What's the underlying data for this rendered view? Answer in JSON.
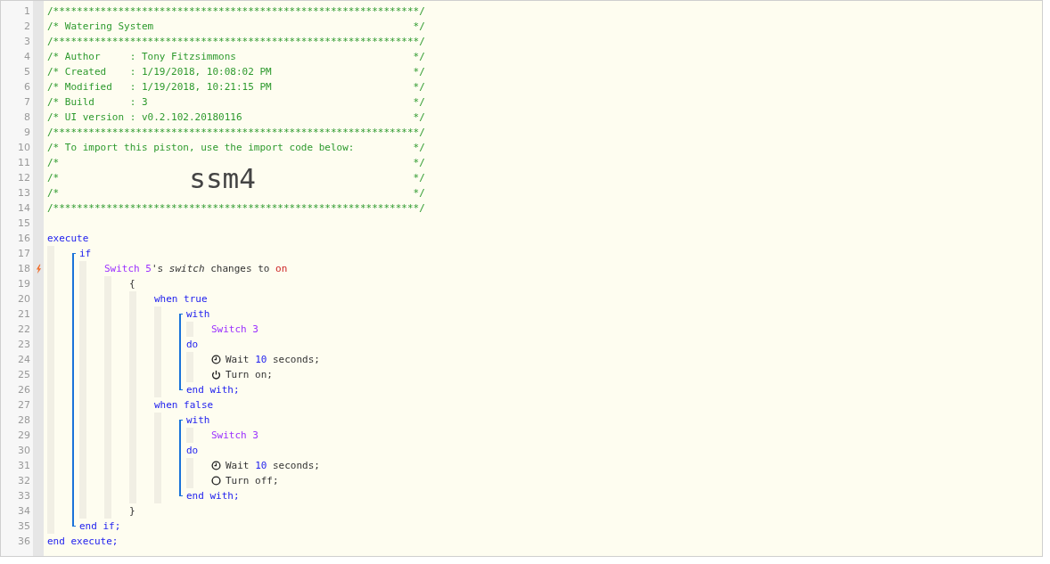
{
  "lines": [
    {
      "n": "1",
      "trigger": false,
      "tokens": [
        {
          "kind": "comment",
          "text": "/**************************************************************/"
        }
      ]
    },
    {
      "n": "2",
      "trigger": false,
      "tokens": [
        {
          "kind": "comment",
          "text": "/* Watering System"
        },
        {
          "kind": "comment-end",
          "text": "*/"
        }
      ]
    },
    {
      "n": "3",
      "trigger": false,
      "tokens": [
        {
          "kind": "comment",
          "text": "/**************************************************************/"
        }
      ]
    },
    {
      "n": "4",
      "trigger": false,
      "tokens": [
        {
          "kind": "comment",
          "text": "/* Author     : Tony Fitzsimmons"
        },
        {
          "kind": "comment-end",
          "text": "*/"
        }
      ]
    },
    {
      "n": "5",
      "trigger": false,
      "tokens": [
        {
          "kind": "comment",
          "text": "/* Created    : 1/19/2018, 10:08:02 PM"
        },
        {
          "kind": "comment-end",
          "text": "*/"
        }
      ]
    },
    {
      "n": "6",
      "trigger": false,
      "tokens": [
        {
          "kind": "comment",
          "text": "/* Modified   : 1/19/2018, 10:21:15 PM"
        },
        {
          "kind": "comment-end",
          "text": "*/"
        }
      ]
    },
    {
      "n": "7",
      "trigger": false,
      "tokens": [
        {
          "kind": "comment",
          "text": "/* Build      : 3"
        },
        {
          "kind": "comment-end",
          "text": "*/"
        }
      ]
    },
    {
      "n": "8",
      "trigger": false,
      "tokens": [
        {
          "kind": "comment",
          "text": "/* UI version : v0.2.102.20180116"
        },
        {
          "kind": "comment-end",
          "text": "*/"
        }
      ]
    },
    {
      "n": "9",
      "trigger": false,
      "tokens": [
        {
          "kind": "comment",
          "text": "/**************************************************************/"
        }
      ]
    },
    {
      "n": "10",
      "trigger": false,
      "tokens": [
        {
          "kind": "comment",
          "text": "/* To import this piston, use the import code below:"
        },
        {
          "kind": "comment-end",
          "text": "*/"
        }
      ]
    },
    {
      "n": "11",
      "trigger": false,
      "tokens": [
        {
          "kind": "comment",
          "text": "/*"
        },
        {
          "kind": "comment-end",
          "text": "*/"
        }
      ]
    },
    {
      "n": "12",
      "trigger": false,
      "tokens": [
        {
          "kind": "comment",
          "text": "/*"
        },
        {
          "kind": "import-code",
          "text": "ssm4"
        },
        {
          "kind": "comment-end",
          "text": "*/"
        }
      ]
    },
    {
      "n": "13",
      "trigger": false,
      "tokens": [
        {
          "kind": "comment",
          "text": "/*"
        },
        {
          "kind": "comment-end",
          "text": "*/"
        }
      ]
    },
    {
      "n": "14",
      "trigger": false,
      "tokens": [
        {
          "kind": "comment",
          "text": "/**************************************************************/"
        }
      ]
    },
    {
      "n": "15",
      "trigger": false
    },
    {
      "n": "16",
      "trigger": false,
      "tokens": [
        {
          "kind": "keyword",
          "text": "execute"
        }
      ],
      "children": [
        {
          "block": [
            {
              "n": "17",
              "trigger": false,
              "tokens": [
                {
                  "kind": "keyword",
                  "text": "if"
                }
              ],
              "children": [
                {
                  "n": "18",
                  "trigger": true,
                  "tokens": [
                    {
                      "kind": "device",
                      "text": "Switch 5"
                    },
                    {
                      "kind": "plain",
                      "text": "'s "
                    },
                    {
                      "kind": "attribute",
                      "text": "switch"
                    },
                    {
                      "kind": "plain",
                      "text": " changes to "
                    },
                    {
                      "kind": "value",
                      "text": "on"
                    }
                  ],
                  "children": [
                    {
                      "n": "19",
                      "trigger": false,
                      "tokens": [
                        {
                          "kind": "plain",
                          "text": "{"
                        }
                      ],
                      "children": [
                        {
                          "n": "20",
                          "trigger": false,
                          "tokens": [
                            {
                              "kind": "keyword",
                              "text": "when true"
                            }
                          ],
                          "children": [
                            {
                              "block": [
                                {
                                  "n": "21",
                                  "trigger": false,
                                  "tokens": [
                                    {
                                      "kind": "keyword",
                                      "text": "with"
                                    }
                                  ],
                                  "children": [
                                    {
                                      "n": "22",
                                      "trigger": false,
                                      "tokens": [
                                        {
                                          "kind": "device",
                                          "text": "Switch 3"
                                        }
                                      ]
                                    }
                                  ]
                                },
                                {
                                  "n": "23",
                                  "trigger": false,
                                  "tokens": [
                                    {
                                      "kind": "keyword",
                                      "text": "do"
                                    }
                                  ],
                                  "children": [
                                    {
                                      "n": "24",
                                      "trigger": false,
                                      "tokens": [
                                        {
                                          "kind": "clock-icon"
                                        },
                                        {
                                          "kind": "plain",
                                          "text": "Wait "
                                        },
                                        {
                                          "kind": "number",
                                          "text": "10"
                                        },
                                        {
                                          "kind": "plain",
                                          "text": " seconds;"
                                        }
                                      ]
                                    },
                                    {
                                      "n": "25",
                                      "trigger": false,
                                      "tokens": [
                                        {
                                          "kind": "power-icon"
                                        },
                                        {
                                          "kind": "plain",
                                          "text": "Turn on;"
                                        }
                                      ]
                                    }
                                  ]
                                }
                              ],
                              "end": {
                                "n": "26",
                                "trigger": false,
                                "tokens": [
                                  {
                                    "kind": "keyword",
                                    "text": "end with;"
                                  }
                                ]
                              }
                            }
                          ]
                        },
                        {
                          "n": "27",
                          "trigger": false,
                          "tokens": [
                            {
                              "kind": "keyword",
                              "text": "when false"
                            }
                          ],
                          "children": [
                            {
                              "block": [
                                {
                                  "n": "28",
                                  "trigger": false,
                                  "tokens": [
                                    {
                                      "kind": "keyword",
                                      "text": "with"
                                    }
                                  ],
                                  "children": [
                                    {
                                      "n": "29",
                                      "trigger": false,
                                      "tokens": [
                                        {
                                          "kind": "device",
                                          "text": "Switch 3"
                                        }
                                      ]
                                    }
                                  ]
                                },
                                {
                                  "n": "30",
                                  "trigger": false,
                                  "tokens": [
                                    {
                                      "kind": "keyword",
                                      "text": "do"
                                    }
                                  ],
                                  "children": [
                                    {
                                      "n": "31",
                                      "trigger": false,
                                      "tokens": [
                                        {
                                          "kind": "clock-icon"
                                        },
                                        {
                                          "kind": "plain",
                                          "text": "Wait "
                                        },
                                        {
                                          "kind": "number",
                                          "text": "10"
                                        },
                                        {
                                          "kind": "plain",
                                          "text": " seconds;"
                                        }
                                      ]
                                    },
                                    {
                                      "n": "32",
                                      "trigger": false,
                                      "tokens": [
                                        {
                                          "kind": "circle-icon"
                                        },
                                        {
                                          "kind": "plain",
                                          "text": "Turn off;"
                                        }
                                      ]
                                    }
                                  ]
                                }
                              ],
                              "end": {
                                "n": "33",
                                "trigger": false,
                                "tokens": [
                                  {
                                    "kind": "keyword",
                                    "text": "end with;"
                                  }
                                ]
                              }
                            }
                          ]
                        }
                      ]
                    },
                    {
                      "n": "34",
                      "trigger": false,
                      "tokens": [
                        {
                          "kind": "plain",
                          "text": "}"
                        }
                      ]
                    }
                  ]
                }
              ]
            }
          ],
          "end": {
            "n": "35",
            "trigger": false,
            "tokens": [
              {
                "kind": "keyword",
                "text": "end if;"
              }
            ]
          }
        }
      ]
    },
    {
      "n": "36",
      "trigger": false,
      "tokens": [
        {
          "kind": "keyword",
          "text": "end execute;"
        }
      ]
    }
  ]
}
